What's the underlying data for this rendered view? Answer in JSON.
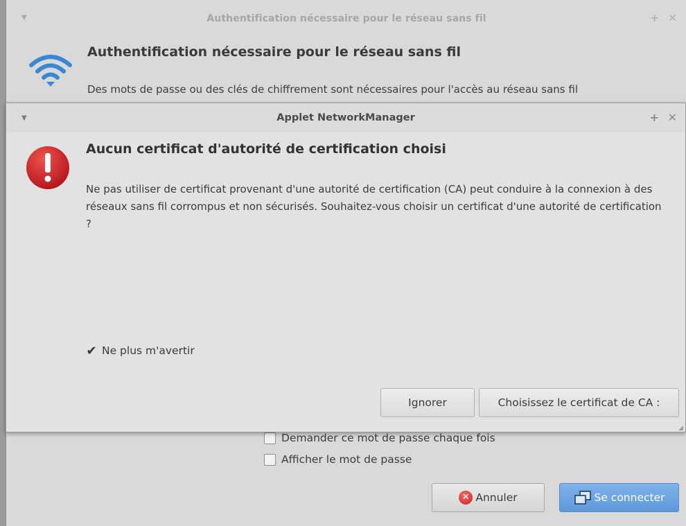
{
  "background_window": {
    "title": "Authentification nécessaire pour le réseau sans fil",
    "heading": "Authentification nécessaire pour le réseau sans fil",
    "description": "Des mots de passe ou des clés de chiffrement sont nécessaires pour l'accès au réseau sans fil",
    "checkboxes": [
      {
        "label": "Demander ce mot de passe chaque fois",
        "checked": false
      },
      {
        "label": "Afficher le mot de passe",
        "checked": false
      }
    ],
    "buttons": {
      "cancel": "Annuler",
      "connect": "Se connecter"
    },
    "icons": {
      "heading": "wifi-icon",
      "cancel": "cancel-icon",
      "connect": "connect-icon"
    }
  },
  "dialog": {
    "title": "Applet NetworkManager",
    "heading": "Aucun certificat d'autorité de certification choisi",
    "body": "Ne pas utiliser de certificat provenant d'une autorité de certification (CA) peut conduire à la connexion à des réseaux sans fil corrompus et non sécurisés. Souhaitez-vous choisir un certificat d'une autorité de certification ?",
    "checkbox": {
      "label": "Ne plus m'avertir",
      "checked": true
    },
    "buttons": {
      "ignore": "Ignorer",
      "choose": "Choisissez le certificat de CA :"
    },
    "icons": {
      "heading": "warning-icon"
    }
  },
  "colors": {
    "accent": "#5e98db",
    "warning": "#d0242b",
    "wifi": "#3a87d4"
  }
}
